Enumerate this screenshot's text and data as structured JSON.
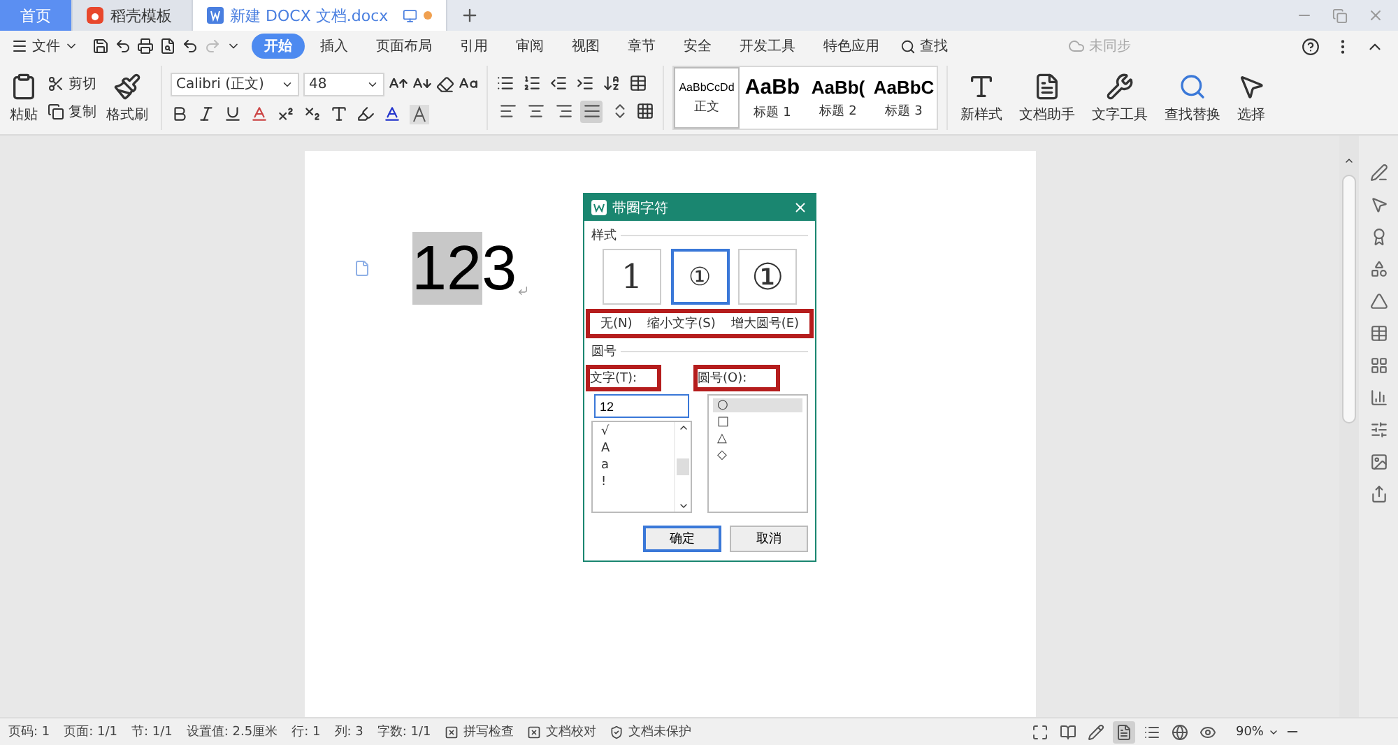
{
  "tabs": [
    {
      "label": "首页",
      "kind": "home",
      "selected": false
    },
    {
      "label": "稻壳模板",
      "kind": "template",
      "selected": false
    },
    {
      "label": "新建 DOCX 文档.docx",
      "kind": "document",
      "selected": true,
      "unsaved": true
    }
  ],
  "menu": {
    "file": "文件",
    "items": [
      {
        "label": "开始",
        "selected": true
      },
      {
        "label": "插入",
        "selected": false
      },
      {
        "label": "页面布局",
        "selected": false
      },
      {
        "label": "引用",
        "selected": false
      },
      {
        "label": "审阅",
        "selected": false
      },
      {
        "label": "视图",
        "selected": false
      },
      {
        "label": "章节",
        "selected": false
      },
      {
        "label": "安全",
        "selected": false
      },
      {
        "label": "开发工具",
        "selected": false
      },
      {
        "label": "特色应用",
        "selected": false
      }
    ],
    "search": "查找",
    "sync": "未同步"
  },
  "ribbon": {
    "paste": "粘贴",
    "cut": "剪切",
    "copy": "复制",
    "format_painter": "格式刷",
    "font": "Calibri (正文)",
    "font_size": "48",
    "align_buttons": [
      {
        "selected": false
      },
      {
        "selected": false
      },
      {
        "selected": false
      },
      {
        "selected": true
      },
      {
        "selected": false
      }
    ],
    "styles": [
      {
        "sample": "AaBbCcDd",
        "name": "正文",
        "kind": "body",
        "selected": true
      },
      {
        "sample": "AaBb",
        "name": "标题 1",
        "kind": "h1",
        "selected": false
      },
      {
        "sample": "AaBb(",
        "name": "标题 2",
        "kind": "h2",
        "selected": false
      },
      {
        "sample": "AaBbC",
        "name": "标题 3",
        "kind": "h3",
        "selected": false
      }
    ],
    "tools": [
      {
        "label": "新样式",
        "kind": "new-style"
      },
      {
        "label": "文档助手",
        "kind": "assistant"
      },
      {
        "label": "文字工具",
        "kind": "text-tools"
      },
      {
        "label": "查找替换",
        "kind": "find"
      },
      {
        "label": "选择",
        "kind": "select"
      }
    ]
  },
  "document": {
    "runs": [
      {
        "text": "12",
        "selected": true
      },
      {
        "text": "3",
        "selected": false
      }
    ]
  },
  "dialog": {
    "title": "带圈字符",
    "style_section": "样式",
    "styles": [
      {
        "glyph": "1",
        "label": "无(N)",
        "kind": "none",
        "selected": false
      },
      {
        "glyph": "①",
        "label": "缩小文字(S)",
        "kind": "shrink",
        "selected": true
      },
      {
        "glyph": "①",
        "label": "增大圆号(E)",
        "kind": "enlarge",
        "selected": false
      }
    ],
    "circle_section": "圆号",
    "text_label": "文字(T):",
    "text_value": "12",
    "text_options": [
      "√",
      "A",
      "a",
      "!"
    ],
    "enclosure_label": "圆号(O):",
    "enclosures": [
      {
        "symbol": "○",
        "selected": true
      },
      {
        "symbol": "□",
        "selected": false
      },
      {
        "symbol": "△",
        "selected": false
      },
      {
        "symbol": "◇",
        "selected": false
      }
    ],
    "buttons": [
      {
        "label": "确定",
        "default": true
      },
      {
        "label": "取消",
        "default": false
      }
    ]
  },
  "status_bar": {
    "items": [
      {
        "label": "页码: 1",
        "kind": "text"
      },
      {
        "label": "页面: 1/1",
        "kind": "text"
      },
      {
        "label": "节: 1/1",
        "kind": "text"
      },
      {
        "label": "设置值: 2.5厘米",
        "kind": "text"
      },
      {
        "label": "行: 1",
        "kind": "text"
      },
      {
        "label": "列: 3",
        "kind": "text"
      },
      {
        "label": "字数: 1/1",
        "kind": "text"
      },
      {
        "label": "拼写检查",
        "kind": "check"
      },
      {
        "label": "文档校对",
        "kind": "check"
      },
      {
        "label": "文档未保护",
        "kind": "protect"
      }
    ],
    "views": [
      {
        "selected": false
      },
      {
        "selected": false
      },
      {
        "selected": false
      },
      {
        "selected": true
      },
      {
        "selected": false
      },
      {
        "selected": false
      },
      {
        "selected": false
      }
    ],
    "zoom": "90%"
  }
}
